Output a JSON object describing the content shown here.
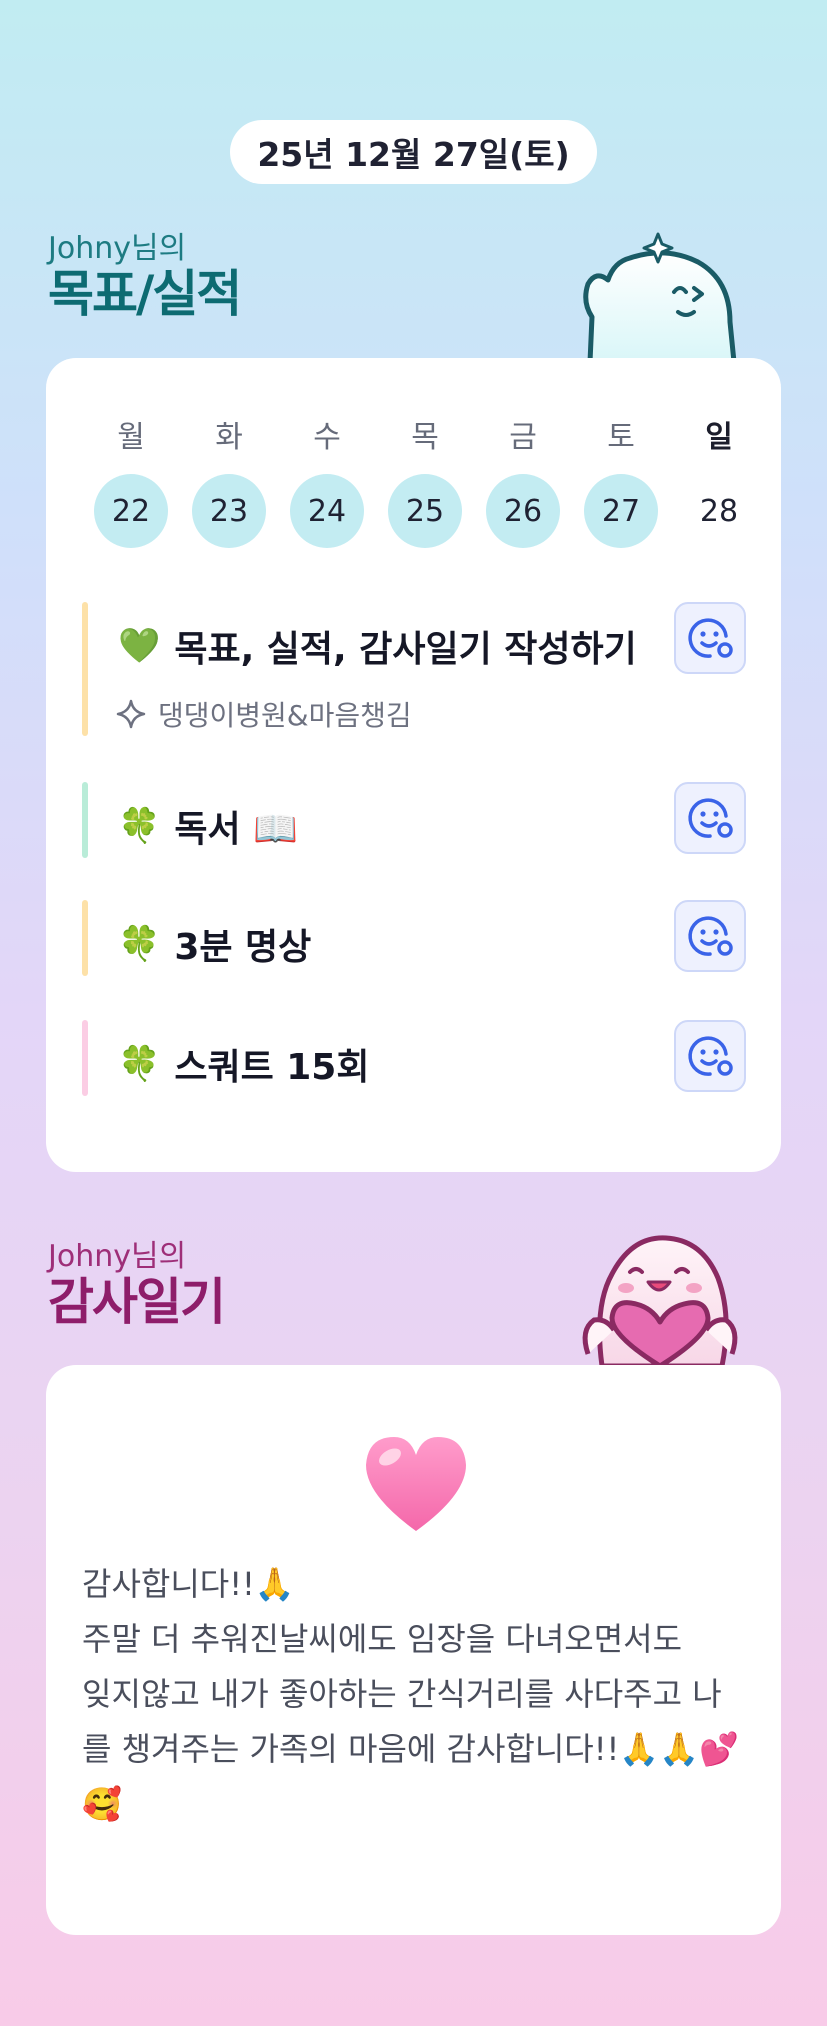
{
  "header": {
    "date": "25년 12월 27일(토)"
  },
  "goals_section": {
    "owner": "Johny님의",
    "title": "목표/실적"
  },
  "week": {
    "days": [
      {
        "name": "월",
        "num": "22",
        "done": true
      },
      {
        "name": "화",
        "num": "23",
        "done": true
      },
      {
        "name": "수",
        "num": "24",
        "done": true
      },
      {
        "name": "목",
        "num": "25",
        "done": true
      },
      {
        "name": "금",
        "num": "26",
        "done": true
      },
      {
        "name": "토",
        "num": "27",
        "done": true
      },
      {
        "name": "일",
        "num": "28",
        "done": false
      }
    ]
  },
  "goals": [
    {
      "emoji": "💚",
      "label": "목표, 실적, 감사일기 작성하기",
      "sub": "댕댕이병원&마음챙김",
      "bar_color": "#fde1a8"
    },
    {
      "emoji": "🍀",
      "label": "독서 📖",
      "bar_color": "#b9ecd8"
    },
    {
      "emoji": "🍀",
      "label": "3분 명상",
      "bar_color": "#fde1a8"
    },
    {
      "emoji": "🍀",
      "label": "스쿼트 15회",
      "bar_color": "#fbcde4"
    }
  ],
  "thanks_section": {
    "owner": "Johny님의",
    "title": "감사일기",
    "body": "감사합니다!!🙏\n주말 더 추워진날씨에도 임장을 다녀오면서도\n잊지않고 내가 좋아하는 간식거리를 사다주고 나를 챙겨주는 가족의 마음에 감사합니다!!🙏🙏💕🥰"
  },
  "colors": {
    "accent_teal": "#0d6b72",
    "accent_magenta": "#8e1d6a",
    "day_circle": "#c3ecf2",
    "reaction_icon": "#3a63e8"
  }
}
